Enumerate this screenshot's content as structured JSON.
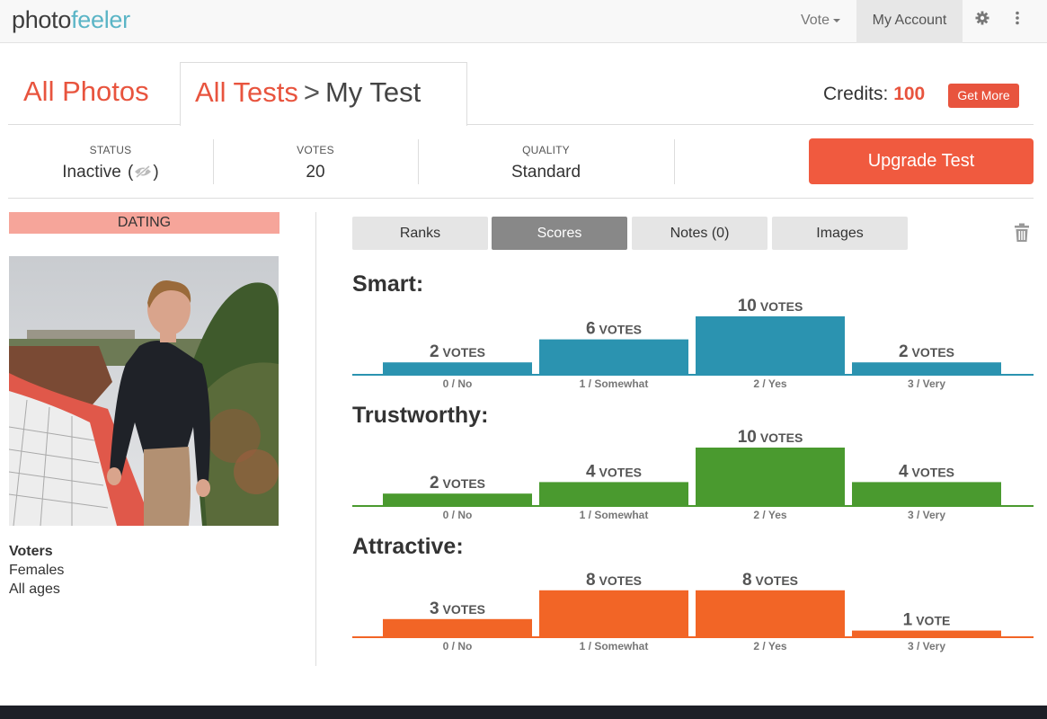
{
  "nav": {
    "logo_part1": "photo",
    "logo_part2": "feeler",
    "vote_label": "Vote",
    "account_label": "My Account",
    "settings_icon": "gear-icon",
    "more_icon": "vertical-dots-icon"
  },
  "header": {
    "all_photos": "All Photos",
    "all_tests": "All Tests",
    "separator": ">",
    "current": "My Test",
    "credits_label": "Credits:",
    "credits_value": "100",
    "get_more": "Get More"
  },
  "stats": {
    "status_label": "STATUS",
    "status_value": "Inactive",
    "status_icon": "eye-slash-icon",
    "votes_label": "VOTES",
    "votes_value": "20",
    "quality_label": "QUALITY",
    "quality_value": "Standard",
    "upgrade": "Upgrade Test"
  },
  "sidebar": {
    "category": "DATING",
    "voters_title": "Voters",
    "voters_gender": "Females",
    "voters_age": "All ages"
  },
  "tabs": [
    {
      "label": "Ranks",
      "active": false
    },
    {
      "label": "Scores",
      "active": true
    },
    {
      "label": "Notes (0)",
      "active": false
    },
    {
      "label": "Images",
      "active": false
    }
  ],
  "chart_data": [
    {
      "type": "bar",
      "title": "Smart:",
      "color": "#2b93b0",
      "categories": [
        "0 / No",
        "1 / Somewhat",
        "2 / Yes",
        "3 / Very"
      ],
      "values": [
        2,
        6,
        10,
        2
      ]
    },
    {
      "type": "bar",
      "title": "Trustworthy:",
      "color": "#4a9a2f",
      "categories": [
        "0 / No",
        "1 / Somewhat",
        "2 / Yes",
        "3 / Very"
      ],
      "values": [
        2,
        4,
        10,
        4
      ]
    },
    {
      "type": "bar",
      "title": "Attractive:",
      "color": "#f26526",
      "categories": [
        "0 / No",
        "1 / Somewhat",
        "2 / Yes",
        "3 / Very"
      ],
      "values": [
        3,
        8,
        8,
        1
      ]
    }
  ],
  "vote_unit_plural": "VOTES",
  "vote_unit_singular": "VOTE"
}
